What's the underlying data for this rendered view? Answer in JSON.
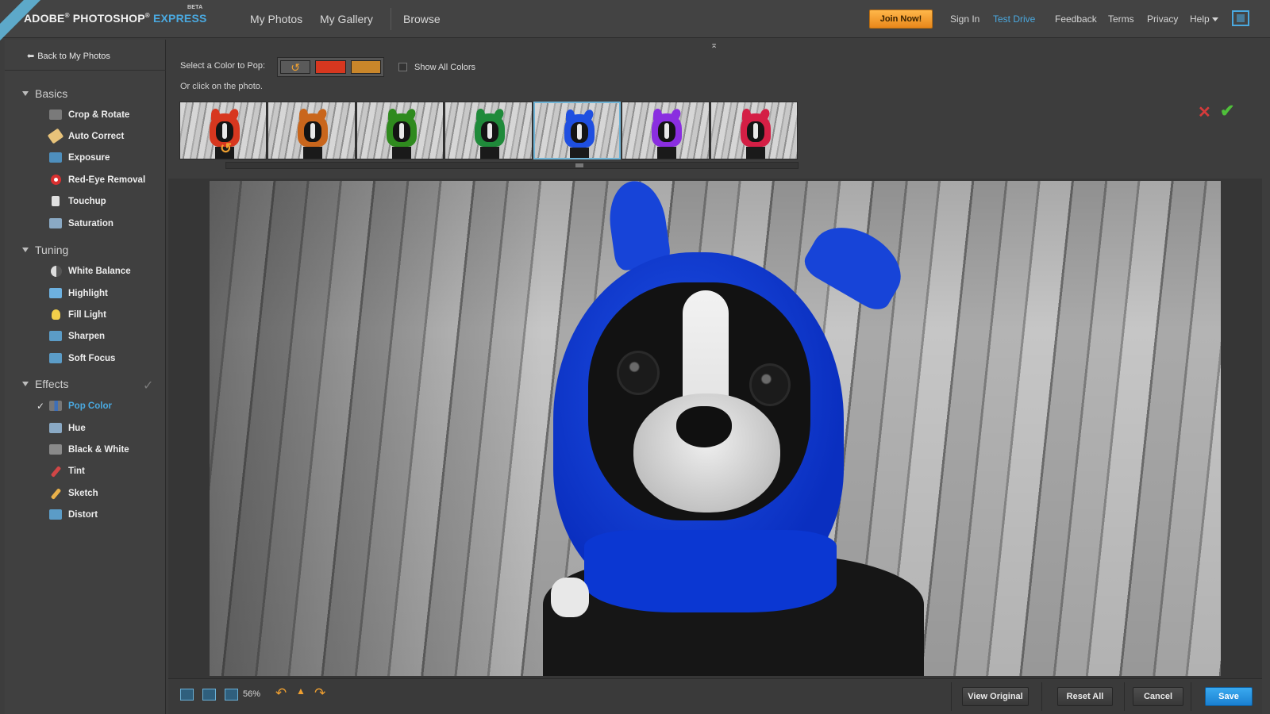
{
  "topbar": {
    "ribbon": "",
    "logo_main": "ADOBE",
    "logo_product": "PHOTOSHOP",
    "logo_express": "EXPRESS",
    "logo_beta": "BETA",
    "nav": [
      "My Photos",
      "My Gallery",
      "Browse"
    ],
    "join_label": "Join Now!",
    "links": [
      "Sign In",
      "Test Drive",
      "Feedback",
      "Terms",
      "Privacy",
      "Help"
    ],
    "active_link": "Test Drive"
  },
  "sidebar": {
    "back_label": "Back to My Photos",
    "sections": [
      {
        "title": "Basics",
        "tools": [
          {
            "label": "Crop & Rotate",
            "icon": "crop-icon"
          },
          {
            "label": "Auto Correct",
            "icon": "auto-correct-icon"
          },
          {
            "label": "Exposure",
            "icon": "exposure-icon"
          },
          {
            "label": "Red-Eye Removal",
            "icon": "red-eye-icon"
          },
          {
            "label": "Touchup",
            "icon": "touchup-icon"
          },
          {
            "label": "Saturation",
            "icon": "saturation-icon"
          }
        ]
      },
      {
        "title": "Tuning",
        "tools": [
          {
            "label": "White Balance",
            "icon": "white-balance-icon"
          },
          {
            "label": "Highlight",
            "icon": "highlight-icon"
          },
          {
            "label": "Fill Light",
            "icon": "fill-light-icon"
          },
          {
            "label": "Sharpen",
            "icon": "sharpen-icon"
          },
          {
            "label": "Soft Focus",
            "icon": "soft-focus-icon"
          }
        ]
      },
      {
        "title": "Effects",
        "tools": [
          {
            "label": "Pop Color",
            "icon": "pop-color-icon"
          },
          {
            "label": "Hue",
            "icon": "hue-icon"
          },
          {
            "label": "Black & White",
            "icon": "black-white-icon"
          },
          {
            "label": "Tint",
            "icon": "tint-icon"
          },
          {
            "label": "Sketch",
            "icon": "sketch-icon"
          },
          {
            "label": "Distort",
            "icon": "distort-icon"
          }
        ]
      }
    ],
    "active_tool": "Pop Color"
  },
  "pop_panel": {
    "select_label": "Select a Color to Pop:",
    "swatches": [
      {
        "name": "undo",
        "color": "#5a5a5a"
      },
      {
        "name": "red",
        "color": "#d7371f"
      },
      {
        "name": "orange",
        "color": "#c9862a"
      }
    ],
    "show_all_label": "Show All Colors",
    "hint": "Or click on the photo.",
    "thumbnails": [
      {
        "color": "#d7371f",
        "selected": false,
        "undo": true
      },
      {
        "color": "#c9661c",
        "selected": false,
        "undo": false
      },
      {
        "color": "#2f8a1e",
        "selected": false,
        "undo": false
      },
      {
        "color": "#1f8a3a",
        "selected": false,
        "undo": false
      },
      {
        "color": "#1f4fe0",
        "selected": true,
        "undo": false
      },
      {
        "color": "#8a2ee0",
        "selected": false,
        "undo": false
      },
      {
        "color": "#d41f45",
        "selected": false,
        "undo": false
      }
    ],
    "cancel_icon": "close-icon",
    "apply_icon": "checkmark-icon"
  },
  "bottombar": {
    "zoom": "56%",
    "buttons": [
      "View Original",
      "Reset All",
      "Cancel",
      "Save"
    ]
  }
}
